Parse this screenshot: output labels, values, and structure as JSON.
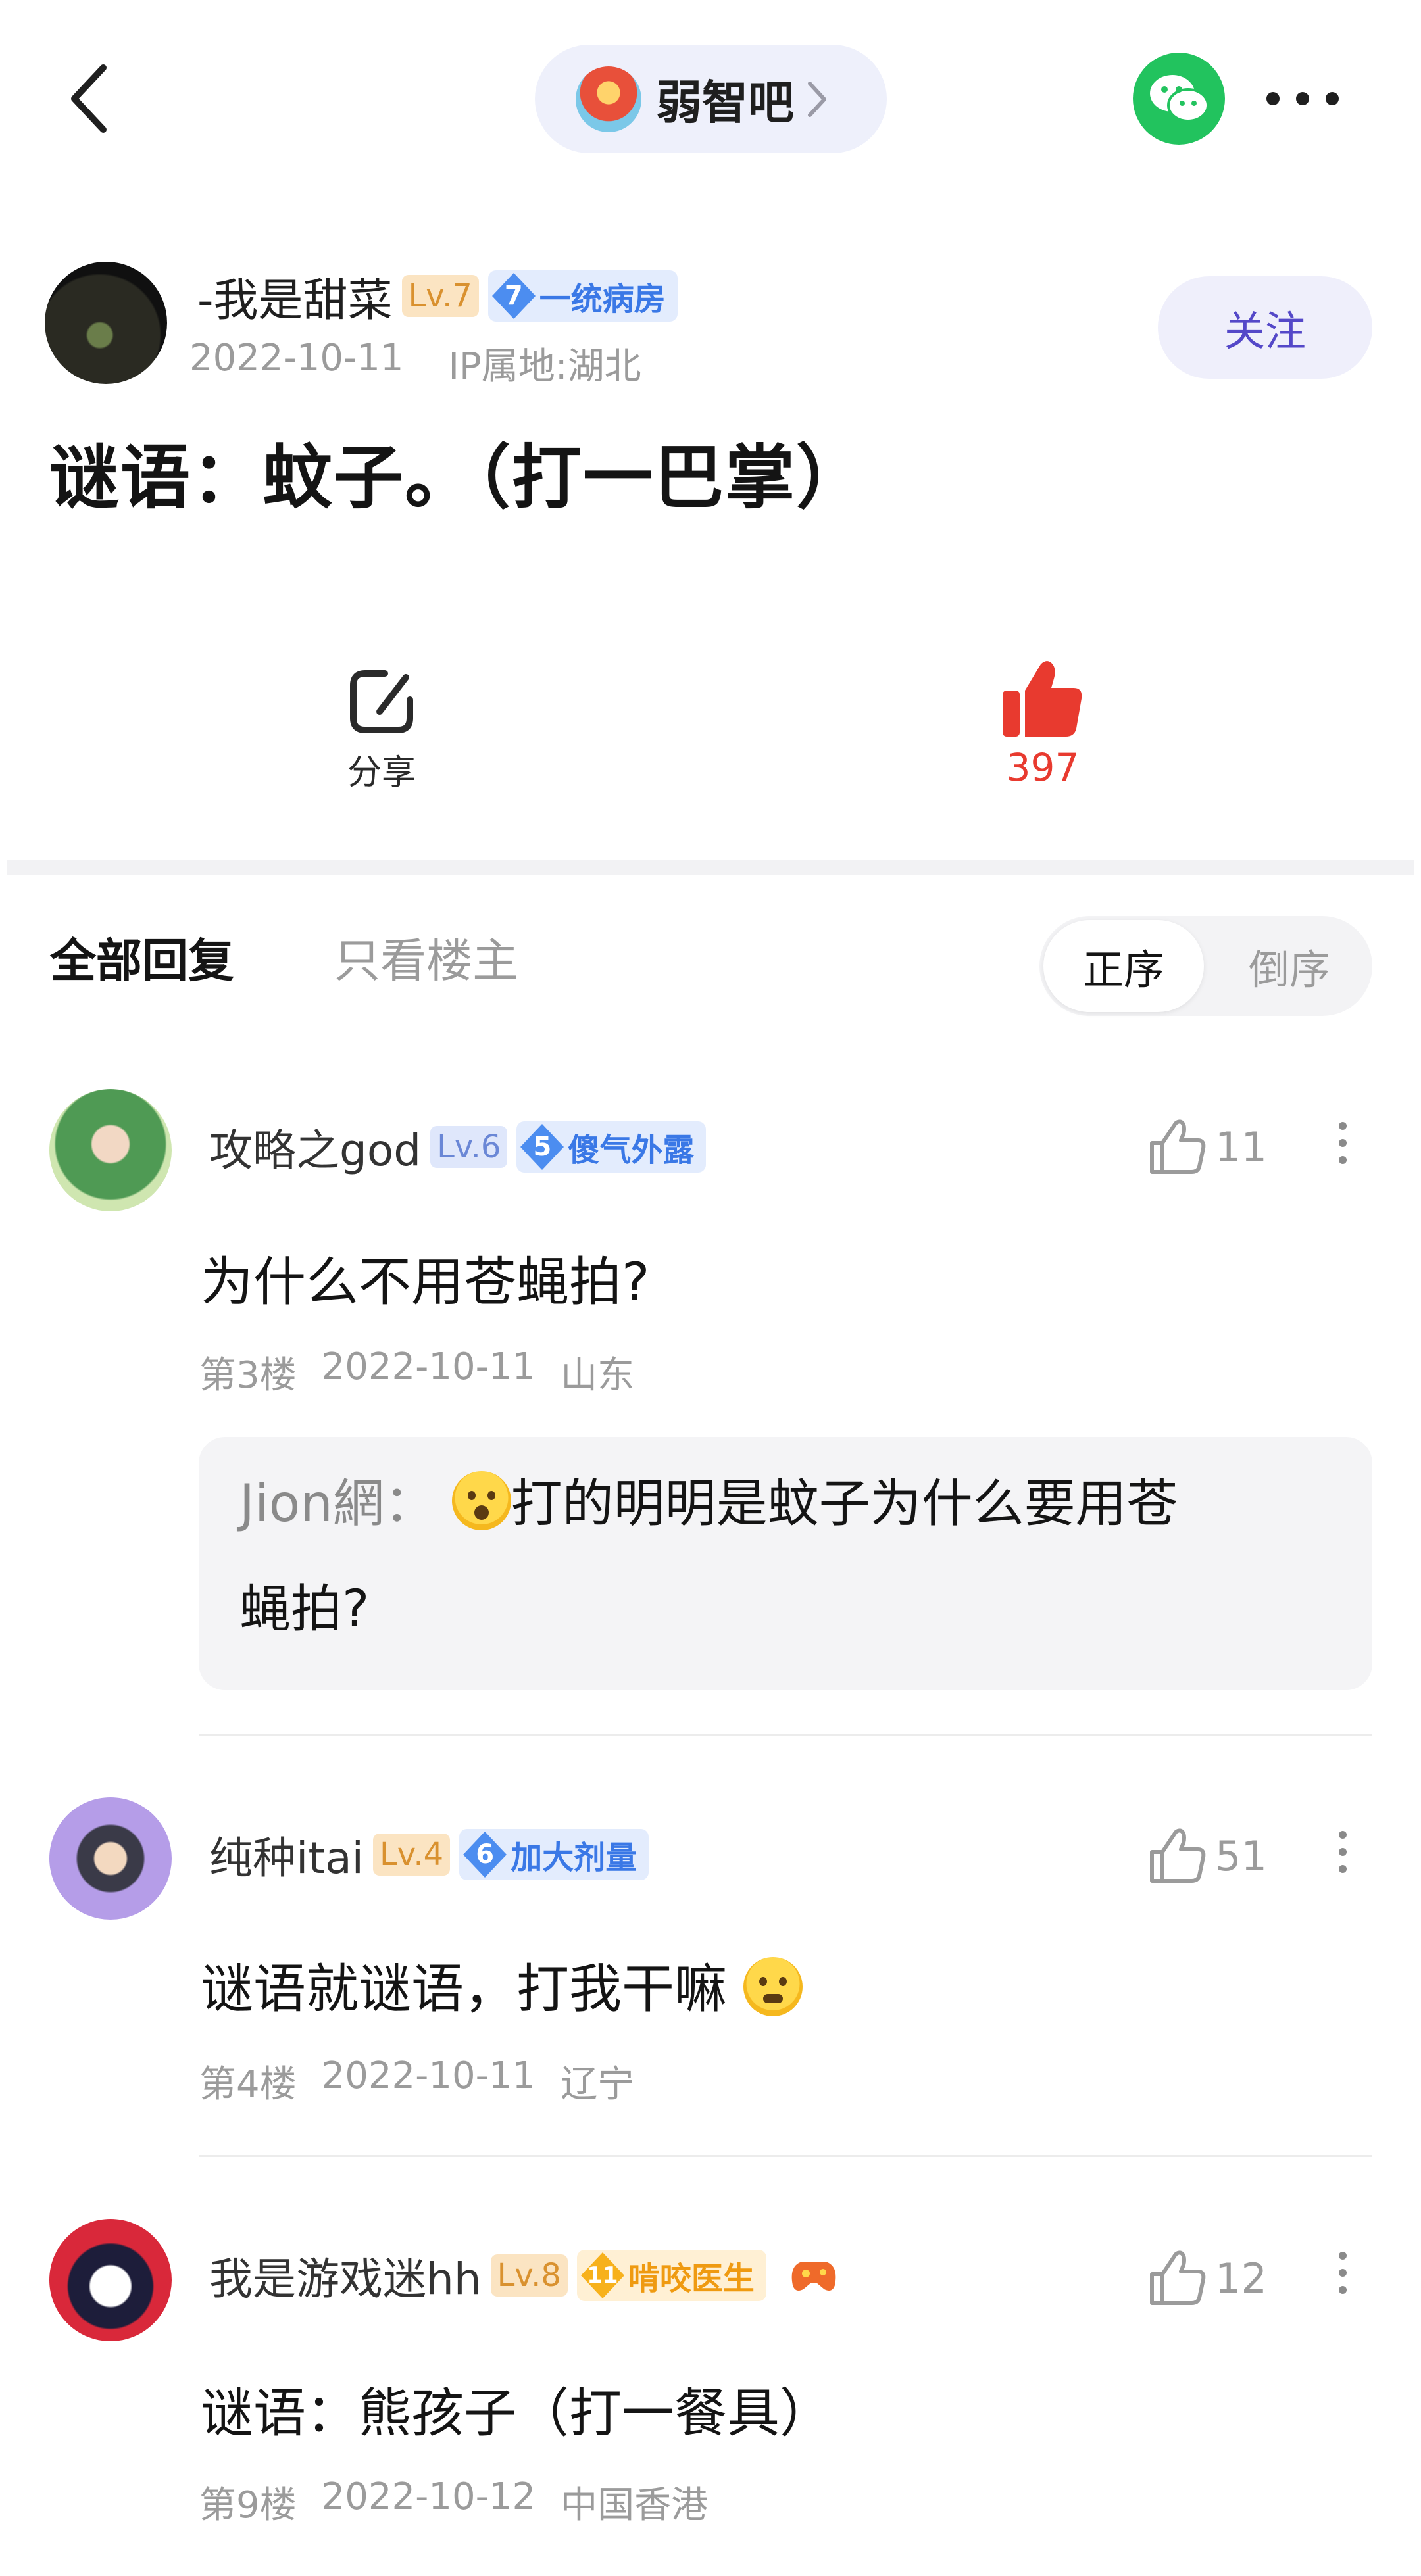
{
  "forum": {
    "name": "弱智吧"
  },
  "post": {
    "author": "-我是甜菜",
    "level": "Lv.7",
    "title_badge_num": "7",
    "title_badge": "一统病房",
    "date": "2022-10-11",
    "ip": "IP属地:湖北",
    "follow_label": "关注",
    "title": "谜语：蚊子。（打一巴掌）",
    "share_label": "分享",
    "like_count": "397"
  },
  "tabs": {
    "all": "全部回复",
    "op_only": "只看楼主"
  },
  "order": {
    "asc": "正序",
    "desc": "倒序"
  },
  "replies": [
    {
      "name": "攻略之god",
      "level": "Lv.6",
      "badge_num": "5",
      "badge": "傻气外露",
      "likes": "11",
      "text": "为什么不用苍蝇拍?",
      "floor": "第3楼",
      "date": "2022-10-11",
      "location": "山东",
      "sub_author": "Jion網：",
      "sub_text_1": "打的明明是蚊子为什么要用苍",
      "sub_text_2": "蝇拍?"
    },
    {
      "name": "纯种itai",
      "level": "Lv.4",
      "badge_num": "6",
      "badge": "加大剂量",
      "likes": "51",
      "text": "谜语就谜语，打我干嘛",
      "floor": "第4楼",
      "date": "2022-10-11",
      "location": "辽宁"
    },
    {
      "name": "我是游戏迷hh",
      "level": "Lv.8",
      "badge_num": "11",
      "badge": "啃咬医生",
      "likes": "12",
      "text": "谜语：熊孩子（打一餐具）",
      "floor": "第9楼",
      "date": "2022-10-12",
      "location": "中国香港"
    }
  ]
}
